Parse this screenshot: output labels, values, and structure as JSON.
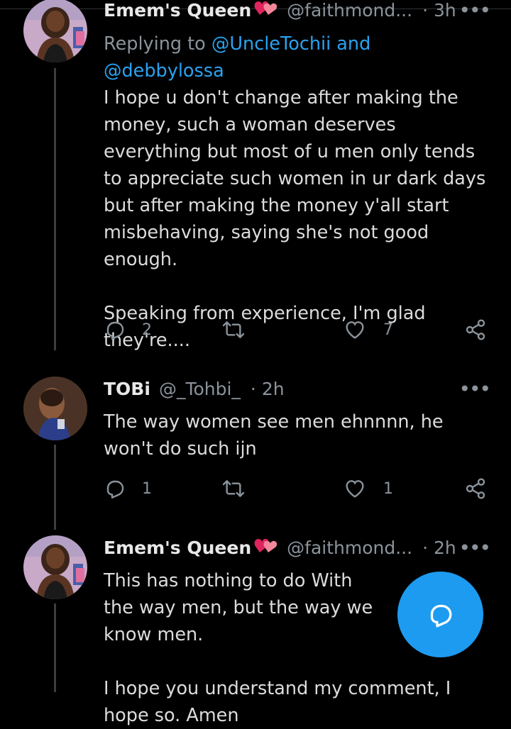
{
  "tweets": [
    {
      "name": "Emem's Queen",
      "handle": "@faithmond...",
      "time": "3h",
      "replying_prefix": "Replying to ",
      "replying_mentions": "@UncleTochii and @debbylossa",
      "paragraphs": [
        "I hope u don't change after making the money, such a woman deserves everything but most of u men only tends to appreciate such women in ur dark days but after making the money y'all start misbehaving, saying she's not good enough.",
        "Speaking from experience, I'm glad they're...."
      ],
      "replies": "2",
      "retweets": "",
      "likes": "7"
    },
    {
      "name": "TOBi",
      "handle": "@_Tohbi_",
      "time": "2h",
      "paragraphs": [
        "The way women  see men ehnnnn, he won't do such ijn"
      ],
      "replies": "1",
      "retweets": "",
      "likes": "1"
    },
    {
      "name": "Emem's Queen",
      "handle": "@faithmond...",
      "time": "2h",
      "paragraphs": [
        "This has nothing to do With the way men, but the way we know men.",
        "I hope you understand my comment, I hope so. Amen"
      ]
    }
  ],
  "colors": {
    "accent": "#1d9bf0",
    "muted": "#8b939b",
    "background": "#000000"
  },
  "icons": [
    "reply-icon",
    "retweet-icon",
    "like-icon",
    "share-icon",
    "more-icon",
    "compose-icon",
    "heart-emoji-icon"
  ]
}
